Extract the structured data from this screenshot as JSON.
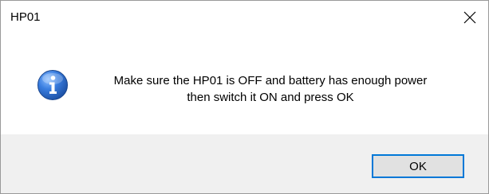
{
  "window": {
    "title": "HP01",
    "close_icon": "close-icon"
  },
  "dialog": {
    "icon": "info-icon",
    "message_line1": "Make sure the HP01 is OFF and battery has enough power",
    "message_line2": "then switch it ON and press OK",
    "ok_label": "OK"
  },
  "colors": {
    "footer_bg": "#f0f0f0",
    "button_focus_border": "#0078d7",
    "icon_blue": "#2a63b8"
  }
}
